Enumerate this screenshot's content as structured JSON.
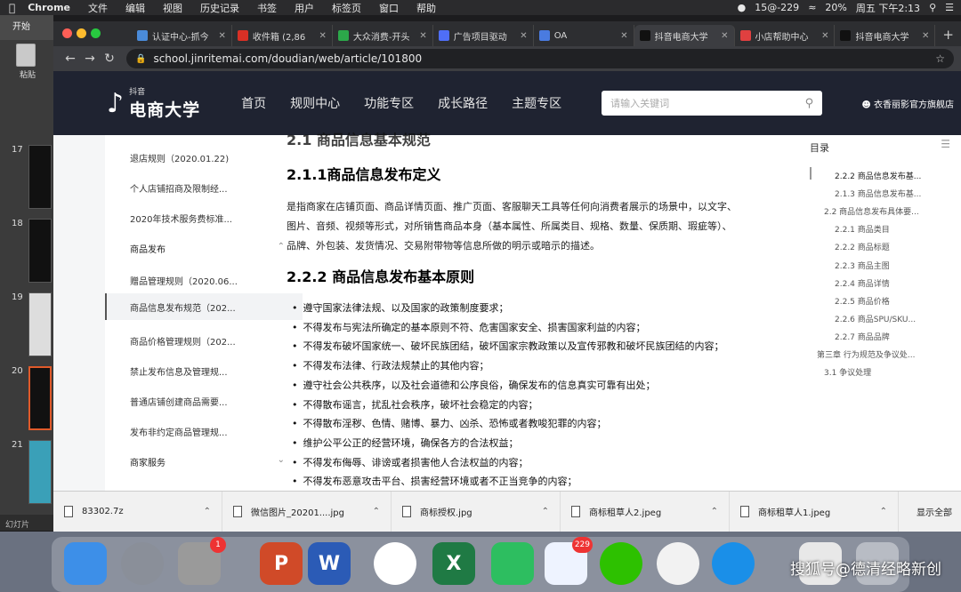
{
  "menubar": {
    "app": "Chrome",
    "items": [
      "文件",
      "编辑",
      "视图",
      "历史记录",
      "书签",
      "用户",
      "标签页",
      "窗口",
      "帮助"
    ],
    "status_right": [
      "15@-229",
      "20%",
      "周五 下午2:13"
    ]
  },
  "ppt": {
    "top_label": "开始",
    "icon_label": "粘贴",
    "slide_numbers": [
      "17",
      "18",
      "19",
      "20",
      "21"
    ],
    "footer": "幻灯片"
  },
  "browser": {
    "tabs": [
      {
        "title": "认证中心-抓今",
        "color": "#4a8bd9"
      },
      {
        "title": "收件箱 (2,86",
        "color": "#d93025"
      },
      {
        "title": "大众消费-开头",
        "color": "#2ca84a"
      },
      {
        "title": "广告项目驱动",
        "color": "#4f6ef7"
      },
      {
        "title": "OA",
        "color": "#4a7be0"
      },
      {
        "title": "抖音电商大学",
        "color": "#111111"
      },
      {
        "title": "小店帮助中心",
        "color": "#e04040"
      },
      {
        "title": "抖音电商大学",
        "color": "#111111"
      }
    ],
    "active_tab_index": 5,
    "url": "school.jinritemai.com/doudian/web/article/101800"
  },
  "site": {
    "logo_small": "抖音",
    "logo_big": "电商大学",
    "nav": [
      "首页",
      "规则中心",
      "功能专区",
      "成长路径",
      "主题专区"
    ],
    "search_placeholder": "请输入关键词",
    "shop_name": "衣香丽影官方旗舰店"
  },
  "sidebar": {
    "items": [
      {
        "label": "退店规则（2020.01.22)"
      },
      {
        "label": "个人店铺招商及限制经..."
      },
      {
        "label": "2020年技术服务费标准..."
      },
      {
        "label": "商品发布",
        "group": true
      },
      {
        "label": "赠品管理规则（2020.06..."
      },
      {
        "label": "商品信息发布规范（202...",
        "active": true
      },
      {
        "label": "商品价格管理规则（202..."
      },
      {
        "label": "禁止发布信息及管理规..."
      },
      {
        "label": "普通店铺创建商品需要..."
      },
      {
        "label": "发布非约定商品管理规..."
      },
      {
        "label": "商家服务",
        "group": true
      }
    ]
  },
  "article": {
    "top_cut_heading": "2.1 商品信息基本规范",
    "h_211": "2.1.1商品信息发布定义",
    "para_lines": [
      "是指商家在店铺页面、商品详情页面、推广页面、客服聊天工具等任何向消费者展示的场景中，以文字、",
      "图片、音频、视频等形式，对所销售商品本身（基本属性、所属类目、规格、数量、保质期、瑕疵等）、",
      "品牌、外包装、发货情况、交易附带物等信息所做的明示或暗示的描述。"
    ],
    "h_222": "2.2.2 商品信息发布基本原则",
    "bullets": [
      "遵守国家法律法规、以及国家的政策制度要求；",
      "不得发布与宪法所确定的基本原则不符、危害国家安全、损害国家利益的内容；",
      "不得发布破坏国家统一、破坏民族团结，破坏国家宗教政策以及宣传邪教和破坏民族团结的内容；",
      "不得发布法律、行政法规禁止的其他内容；",
      "遵守社会公共秩序，以及社会道德和公序良俗，确保发布的信息真实可靠有出处；",
      "不得散布谣言，扰乱社会秩序，破坏社会稳定的内容；",
      "不得散布淫秽、色情、赌博、暴力、凶杀、恐怖或者教唆犯罪的内容；",
      "维护公平公正的经营环境，确保各方的合法权益；",
      "不得发布侮辱、诽谤或者损害他人合法权益的内容；",
      "不得发布恶意攻击平台、损害经营环境或者不正当竞争的内容；"
    ]
  },
  "toc": {
    "title": "目录",
    "items": [
      {
        "label": "2.2.2 商品信息发布基..."
      },
      {
        "label": "2.1.3 商品信息发布基..."
      },
      {
        "label": "2.2 商品信息发布具体要..."
      },
      {
        "label": "2.2.1 商品类目"
      },
      {
        "label": "2.2.2 商品标题"
      },
      {
        "label": "2.2.3 商品主图"
      },
      {
        "label": "2.2.4 商品详情"
      },
      {
        "label": "2.2.5 商品价格"
      },
      {
        "label": "2.2.6 商品SPU/SKU..."
      },
      {
        "label": "2.2.7 商品品牌"
      },
      {
        "label": "第三章 行为规范及争议处..."
      },
      {
        "label": "3.1 争议处理"
      }
    ]
  },
  "downloads": {
    "items": [
      "83302.7z",
      "微信图片_20201....jpg",
      "商标授权.jpg",
      "商标租草人2.jpeg",
      "商标租草人1.jpeg"
    ],
    "show_all": "显示全部"
  },
  "dock": {
    "apps": [
      {
        "name": "finder",
        "color": "#3d8fe8"
      },
      {
        "name": "launchpad",
        "color": "#8a8f99"
      },
      {
        "name": "system-preferences",
        "color": "#9a9a9a",
        "badge": "1"
      },
      {
        "name": "powerpoint",
        "color": "#d04a28",
        "letter": "P"
      },
      {
        "name": "word",
        "color": "#2b5bb6",
        "letter": "W"
      },
      {
        "name": "chrome",
        "color": "#ffffff"
      },
      {
        "name": "excel",
        "color": "#1f7a44",
        "letter": "X"
      },
      {
        "name": "evernote",
        "color": "#2dbe60"
      },
      {
        "name": "feishu",
        "color": "#eef3ff",
        "badge": "229"
      },
      {
        "name": "wechat",
        "color": "#2dc100"
      },
      {
        "name": "ticktick",
        "color": "#f2f2f2"
      },
      {
        "name": "qq",
        "color": "#1a8fe8"
      },
      {
        "name": "preview",
        "color": "#e8e8e8"
      },
      {
        "name": "trash",
        "color": "#b8bcc4"
      }
    ],
    "watermark": "搜狐号@德清经略新创"
  }
}
